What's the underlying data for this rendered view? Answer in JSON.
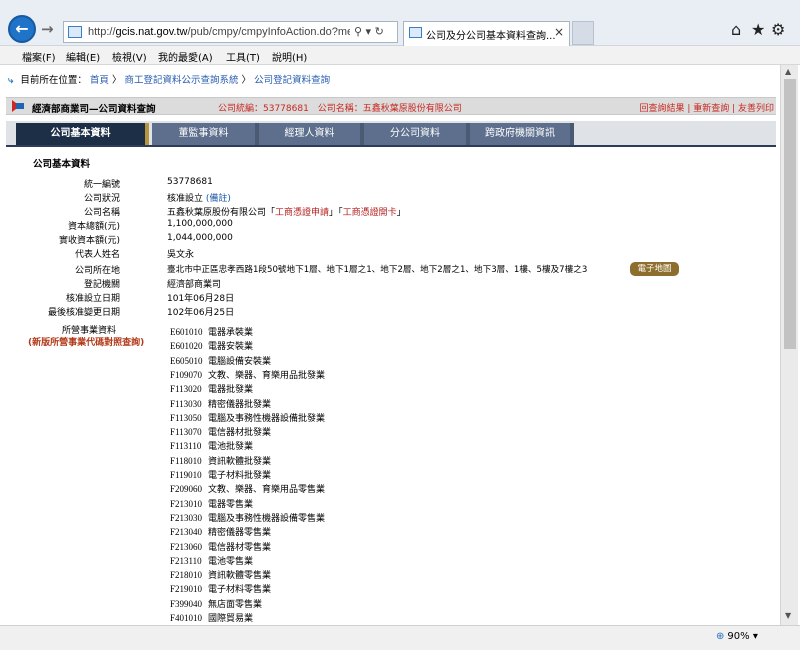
{
  "browser": {
    "url_host": "gcis.nat.gov.tw",
    "url_prefix": "http://",
    "url_path": "/pub/cmpy/cmpyInfoAction.do?me",
    "address_controls": "⚲ ▾ ↻",
    "tab_title": "公司及分公司基本資料查詢...",
    "tab_close": "×",
    "menu": [
      "檔案(F)",
      "編輯(E)",
      "檢視(V)",
      "我的最愛(A)",
      "工具(T)",
      "說明(H)"
    ],
    "window_icons": [
      "⌂",
      "★",
      "⚙"
    ],
    "zoom": "90%"
  },
  "breadcrumb": {
    "prefix": "目前所在位置：",
    "home": "首頁",
    "sep": "〉",
    "level1": "商工登記資料公示查詢系統",
    "level2": "公司登記資料查詢"
  },
  "header": {
    "title": "經濟部商業司—公司資料查詢",
    "info": "公司統編：53778681　公司名稱：五鑫秋葉原股份有限公司",
    "links": "回查詢結果 | 重新查詢 | 友善列印"
  },
  "tabs": [
    "公司基本資料",
    "董監事資料",
    "經理人資料",
    "分公司資料",
    "跨政府機關資訊"
  ],
  "section_title": "公司基本資料",
  "fields": {
    "tax_id": {
      "label": "統一編號",
      "value": "53778681"
    },
    "status": {
      "label": "公司狀況",
      "value": "核准設立",
      "note": "(備註)"
    },
    "name": {
      "label": "公司名稱",
      "value": "五鑫秋葉原股份有限公司",
      "link1": "工商憑證申請",
      "link2": "工商憑證開卡",
      "bracket_open": "「",
      "bracket_close": "」"
    },
    "capital": {
      "label": "資本總額(元)",
      "value": "1,100,000,000"
    },
    "paid_capital": {
      "label": "實收資本額(元)",
      "value": "1,044,000,000"
    },
    "representative": {
      "label": "代表人姓名",
      "value": "吳文永"
    },
    "address": {
      "label": "公司所在地",
      "value": "臺北市中正區忠孝西路1段50號地下1層、地下1層之1、地下2層、地下2層之1、地下3層、1樓、5樓及7樓之3",
      "map_button": "電子地圖"
    },
    "authority": {
      "label": "登記機關",
      "value": "經濟部商業司"
    },
    "established": {
      "label": "核准設立日期",
      "value": "101年06月28日"
    },
    "last_changed": {
      "label": "最後核准變更日期",
      "value": "102年06月25日"
    }
  },
  "business": {
    "label": "所營事業資料",
    "lookup_link": "(新版所營事業代碼對照查詢)",
    "items": [
      {
        "code": "E601010",
        "name": "電器承裝業"
      },
      {
        "code": "E601020",
        "name": "電器安裝業"
      },
      {
        "code": "E605010",
        "name": "電腦設備安裝業"
      },
      {
        "code": "F109070",
        "name": "文教、樂器、育樂用品批發業"
      },
      {
        "code": "F113020",
        "name": "電器批發業"
      },
      {
        "code": "F113030",
        "name": "精密儀器批發業"
      },
      {
        "code": "F113050",
        "name": "電腦及事務性機器設備批發業"
      },
      {
        "code": "F113070",
        "name": "電信器材批發業"
      },
      {
        "code": "F113110",
        "name": "電池批發業"
      },
      {
        "code": "F118010",
        "name": "資訊軟體批發業"
      },
      {
        "code": "F119010",
        "name": "電子材料批發業"
      },
      {
        "code": "F209060",
        "name": "文教、樂器、育樂用品零售業"
      },
      {
        "code": "F213010",
        "name": "電器零售業"
      },
      {
        "code": "F213030",
        "name": "電腦及事務性機器設備零售業"
      },
      {
        "code": "F213040",
        "name": "精密儀器零售業"
      },
      {
        "code": "F213060",
        "name": "電信器材零售業"
      },
      {
        "code": "F213110",
        "name": "電池零售業"
      },
      {
        "code": "F218010",
        "name": "資訊軟體零售業"
      },
      {
        "code": "F219010",
        "name": "電子材料零售業"
      },
      {
        "code": "F399040",
        "name": "無店面零售業"
      },
      {
        "code": "F401010",
        "name": "國際貿易業"
      }
    ]
  },
  "colors": {
    "accent_red": "#c9271f",
    "tab_dark": "#1d2f47",
    "tab_normal": "#5d6f8c",
    "map_button": "#8d6e2c",
    "link_blue": "#1a56a8"
  }
}
